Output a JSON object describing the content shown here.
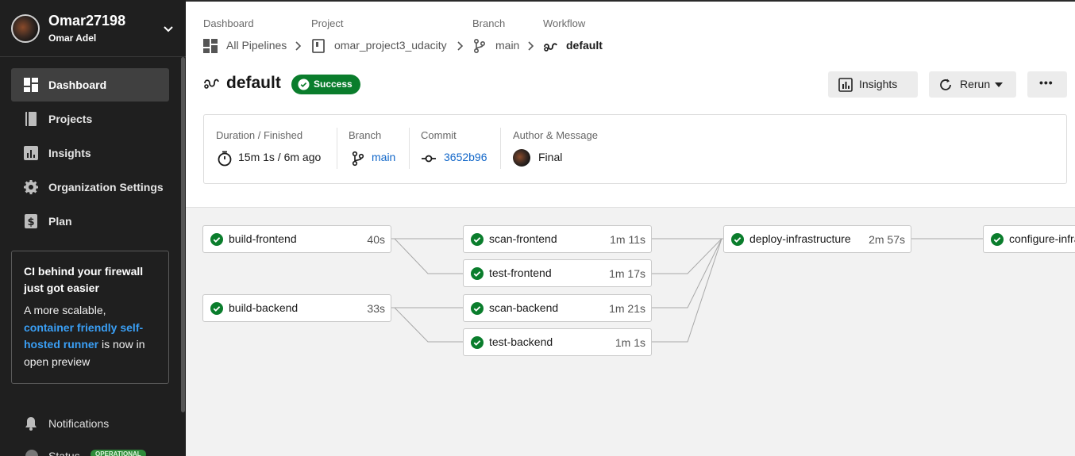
{
  "user": {
    "username": "Omar27198",
    "full_name": "Omar Adel"
  },
  "sidebar": {
    "items": [
      {
        "label": "Dashboard",
        "icon": "dashboard-icon",
        "active": true
      },
      {
        "label": "Projects",
        "icon": "book-icon"
      },
      {
        "label": "Insights",
        "icon": "bar-chart-icon"
      },
      {
        "label": "Organization Settings",
        "icon": "gear-icon"
      },
      {
        "label": "Plan",
        "icon": "dollar-icon"
      }
    ],
    "promo": {
      "title": "CI behind your firewall just got easier",
      "body_prefix": "A more scalable, ",
      "link": "container friendly self-hosted runner",
      "body_suffix": " is now in open preview"
    },
    "notifications_label": "Notifications",
    "status_label": "Status",
    "status_badge": "OPERATIONAL"
  },
  "breadcrumb": {
    "dashboard": {
      "label": "Dashboard",
      "value": "All Pipelines"
    },
    "project": {
      "label": "Project",
      "value": "omar_project3_udacity"
    },
    "branch": {
      "label": "Branch",
      "value": "main"
    },
    "workflow": {
      "label": "Workflow",
      "value": "default"
    }
  },
  "workflow": {
    "title": "default",
    "status": "Success",
    "status_color": "#0a7d2c"
  },
  "actions": {
    "insights": "Insights",
    "rerun": "Rerun",
    "more": "•••"
  },
  "info": {
    "duration_label": "Duration / Finished",
    "duration_value": "15m 1s / 6m ago",
    "branch_label": "Branch",
    "branch_value": "main",
    "commit_label": "Commit",
    "commit_value": "3652b96",
    "author_label": "Author & Message",
    "author_message": "Final"
  },
  "jobs": [
    {
      "name": "build-frontend",
      "duration": "40s"
    },
    {
      "name": "build-backend",
      "duration": "33s"
    },
    {
      "name": "scan-frontend",
      "duration": "1m 11s"
    },
    {
      "name": "test-frontend",
      "duration": "1m 17s"
    },
    {
      "name": "scan-backend",
      "duration": "1m 21s"
    },
    {
      "name": "test-backend",
      "duration": "1m 1s"
    },
    {
      "name": "deploy-infrastructure",
      "duration": "2m 57s"
    },
    {
      "name": "configure-infrastructure",
      "duration": ""
    }
  ],
  "colors": {
    "accent": "#0a7d2c",
    "link": "#1267c9",
    "sidebar_bg": "#1f1f1f"
  }
}
